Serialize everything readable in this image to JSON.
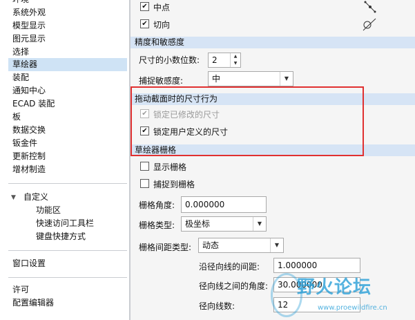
{
  "sidebar": {
    "items": [
      "环境",
      "系统外观",
      "模型显示",
      "图元显示",
      "选择",
      "草绘器",
      "装配",
      "通知中心",
      "ECAD 装配",
      "板",
      "数据交换",
      "钣金件",
      "更新控制",
      "增材制造"
    ],
    "customize": {
      "label": "自定义",
      "children": [
        "功能区",
        "快速访问工具栏",
        "键盘快捷方式"
      ]
    },
    "window_settings": "窗口设置",
    "license": "许可",
    "config_editor": "配置编辑器"
  },
  "main": {
    "midpoint": {
      "label": "中点",
      "checked": true
    },
    "tangent": {
      "label": "切向",
      "checked": true
    },
    "precision": {
      "title": "精度和敏感度",
      "decimals_label": "尺寸的小数位数:",
      "decimals_value": "2",
      "snap_label": "捕捉敏感度:",
      "snap_value": "中"
    },
    "drag": {
      "title": "拖动截面时的尺寸行为",
      "lock_modified": {
        "label": "锁定已修改的尺寸",
        "checked": true,
        "enabled": false
      },
      "lock_user": {
        "label": "锁定用户定义的尺寸",
        "checked": true
      }
    },
    "grid": {
      "title": "草绘器栅格",
      "show_grid": {
        "label": "显示栅格",
        "checked": false
      },
      "snap_grid": {
        "label": "捕捉到栅格",
        "checked": false
      },
      "angle_label": "栅格角度:",
      "angle_value": "0.000000",
      "type_label": "栅格类型:",
      "type_value": "极坐标",
      "spacing_label": "栅格间距类型:",
      "spacing_value": "动态",
      "radial_label": "沿径向线的间距:",
      "radial_value": "1.000000",
      "between_label": "径向线之间的角度:",
      "between_value": "30.000000",
      "count_label": "径向线数:",
      "count_value": "12"
    }
  },
  "watermark": {
    "text": "野火论坛",
    "url": "www.proewildfire.cn"
  },
  "colors": {
    "section_bg": "#d6e4f5",
    "selected_bg": "#cfe3f5",
    "highlight": "#e03030",
    "watermark": "#2aa0d8"
  }
}
